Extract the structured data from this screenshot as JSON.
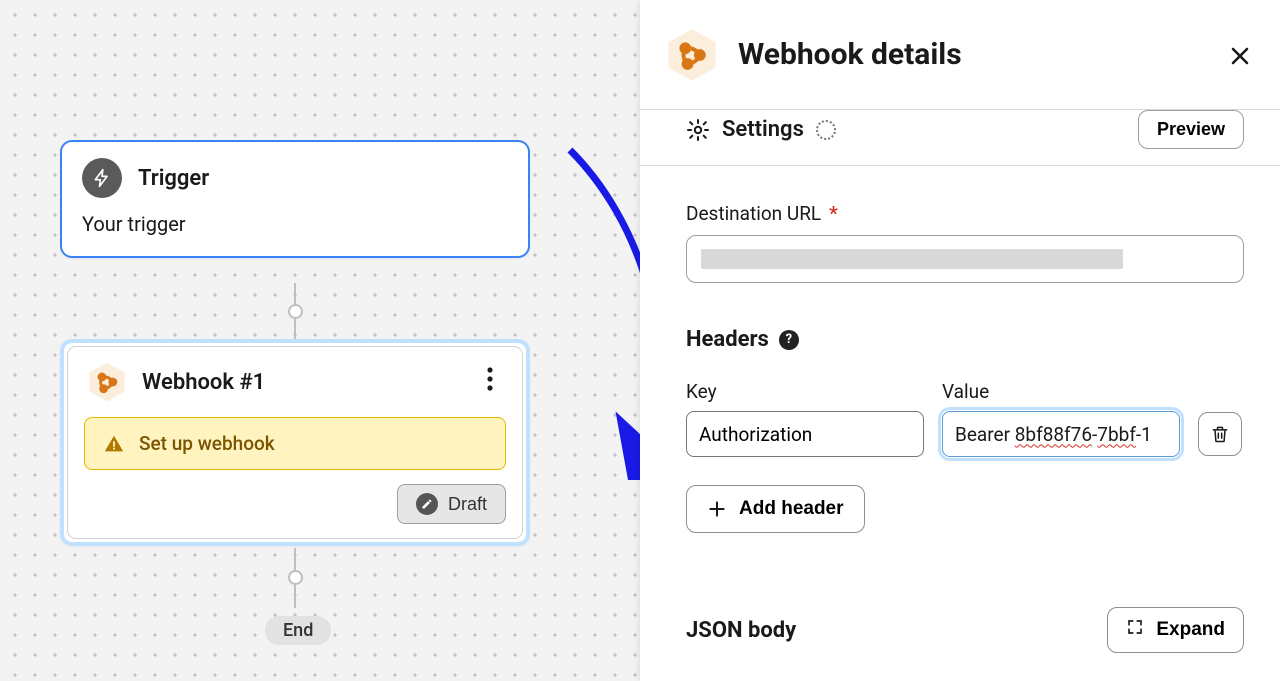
{
  "canvas": {
    "trigger": {
      "title": "Trigger",
      "body": "Your trigger"
    },
    "webhook": {
      "title": "Webhook #1",
      "warning": "Set up webhook",
      "draft_label": "Draft"
    },
    "end_label": "End"
  },
  "panel": {
    "title": "Webhook details",
    "settings_label": "Settings",
    "preview_label": "Preview",
    "destination_label": "Destination URL",
    "headers_label": "Headers",
    "help_tooltip": "?",
    "key_col": "Key",
    "value_col": "Value",
    "header_row": {
      "key": "Authorization",
      "value": "Bearer 8bf88f76-7bbf-1"
    },
    "add_header_label": "Add header",
    "json_body_label": "JSON body",
    "expand_label": "Expand"
  },
  "colors": {
    "accent_orange": "#d97615",
    "focus_blue": "#bfe0ff",
    "node_border": "#3b82f6",
    "warn_bg": "#fff3bf",
    "warn_border": "#e6b800",
    "warn_text": "#7a5500"
  }
}
